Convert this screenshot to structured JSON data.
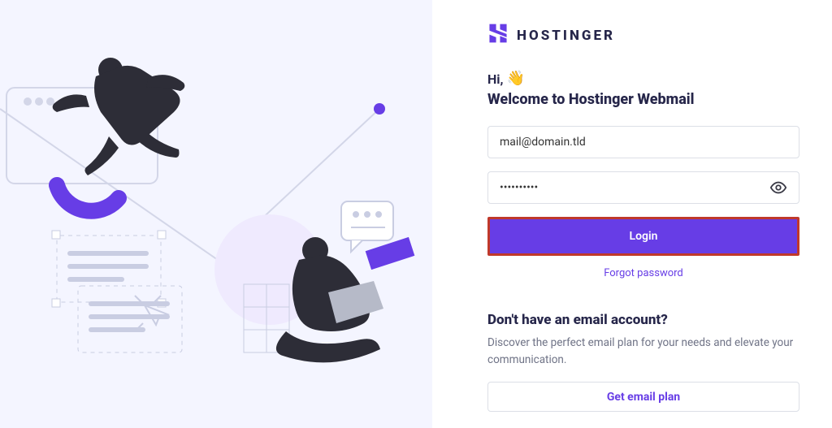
{
  "brand": {
    "name": "HOSTINGER"
  },
  "greeting": {
    "hi": "Hi,",
    "wave": "👋",
    "welcome": "Welcome to Hostinger Webmail"
  },
  "form": {
    "email_value": "mail@domain.tld",
    "password_value": "••••••••••",
    "login_label": "Login",
    "forgot_label": "Forgot password"
  },
  "cta": {
    "heading": "Don't have an email account?",
    "body": "Discover the perfect email plan for your needs and elevate your communication.",
    "button": "Get email plan"
  },
  "colors": {
    "accent": "#673de6",
    "highlight_border": "#c0392b"
  }
}
